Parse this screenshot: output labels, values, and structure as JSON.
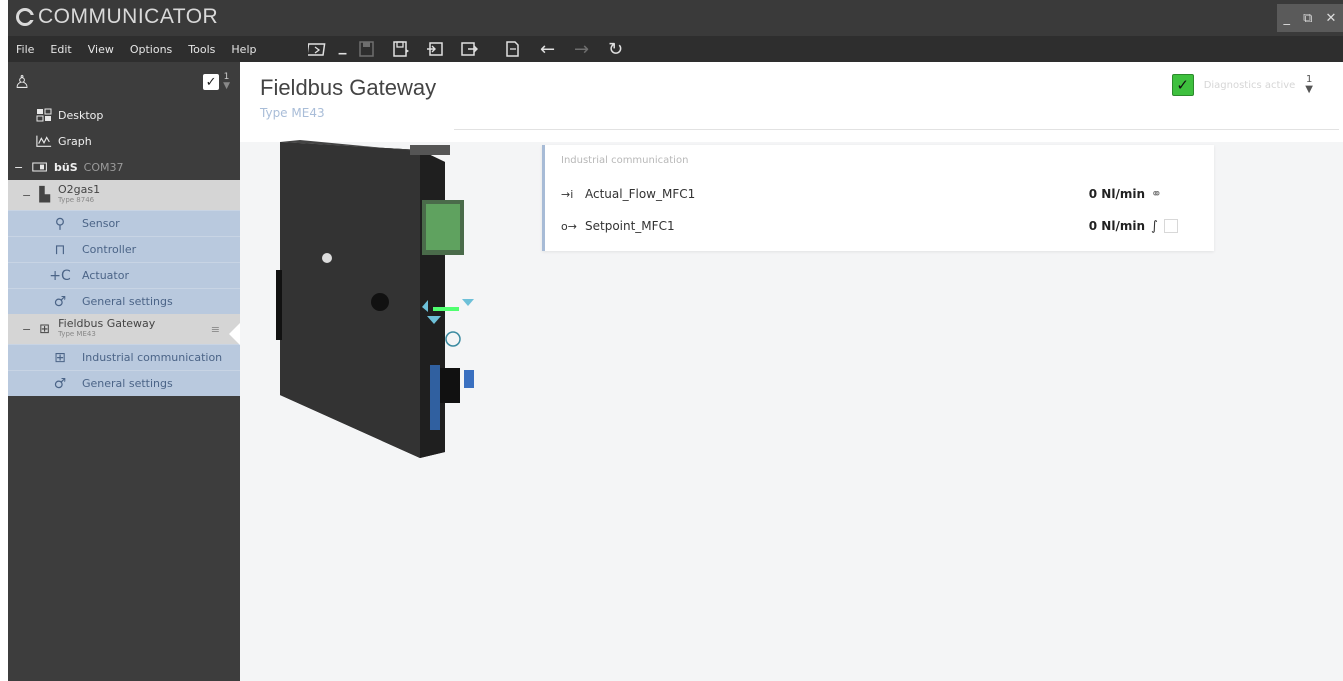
{
  "window": {
    "app_title": "COMMUNICATOR",
    "controls": [
      "_",
      "⧉",
      "✕"
    ]
  },
  "menu": [
    "File",
    "Edit",
    "View",
    "Options",
    "Tools",
    "Help"
  ],
  "toolbar": [
    {
      "icon": "device-view-icon"
    },
    {
      "icon": "dropdown-icon"
    },
    {
      "icon": "save-disabled-icon"
    },
    {
      "icon": "save-icon"
    },
    {
      "icon": "import-icon"
    },
    {
      "icon": "export-icon"
    },
    {
      "icon": "report-icon"
    },
    {
      "icon": "back-arrow-icon"
    },
    {
      "icon": "forward-arrow-icon"
    },
    {
      "icon": "refresh-icon"
    }
  ],
  "sidebar": {
    "top_count": "1",
    "nav": [
      {
        "label": "Desktop",
        "icon": "desktop-icon"
      },
      {
        "label": "Graph",
        "icon": "graph-icon"
      }
    ],
    "interface": {
      "name": "büS",
      "port": "COM37"
    },
    "devices": [
      {
        "name": "O2gas1",
        "type": "Type 8746",
        "items": [
          "Sensor",
          "Controller",
          "Actuator",
          "General settings"
        ]
      },
      {
        "name": "Fieldbus Gateway",
        "type": "Type ME43",
        "items": [
          "Industrial communication",
          "General settings"
        ]
      }
    ]
  },
  "main": {
    "title": "Fieldbus Gateway",
    "subtitle": "Type ME43",
    "diagnostics_label": "Diagnostics active",
    "diagnostics_count": "1",
    "panel": {
      "title": "Industrial communication",
      "rows": [
        {
          "direction": "→i",
          "name": "Actual_Flow_MFC1",
          "value": "0 Nl/min"
        },
        {
          "direction": "o→",
          "name": "Setpoint_MFC1",
          "value": "0 Nl/min"
        }
      ]
    }
  },
  "colors": {
    "titlebar": "#3a3a3a",
    "sidebar": "#3d3d3d",
    "selection_blue": "#b9c9de",
    "diagnostics_green": "#3ec03e"
  }
}
